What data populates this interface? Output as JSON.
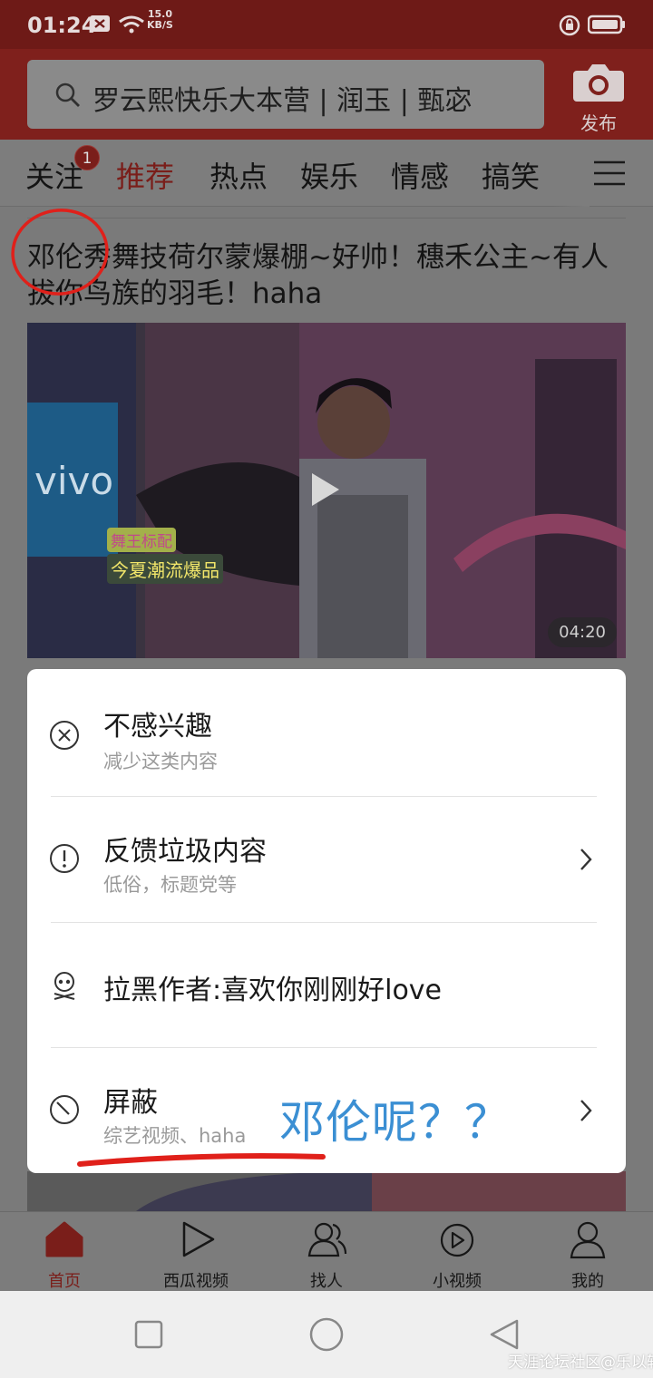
{
  "status_bar": {
    "time": "01:24",
    "speed_value": "15.0",
    "speed_unit": "KB/S"
  },
  "header": {
    "search_text": "罗云熙快乐大本营 | 润玉 | 甄宓",
    "publish_label": "发布"
  },
  "tabs": {
    "items": [
      {
        "label": "关注",
        "badge": "1"
      },
      {
        "label": "推荐"
      },
      {
        "label": "热点"
      },
      {
        "label": "娱乐"
      },
      {
        "label": "情感"
      },
      {
        "label": "搞笑"
      }
    ],
    "active_index": 1
  },
  "feed": {
    "headline": "邓伦秀舞技荷尔蒙爆棚~好帅！穗禾公主~有人拔你鸟族的羽毛！haha",
    "video": {
      "duration": "04:20",
      "overlay_line1": "舞王标配",
      "overlay_line2": "今夏潮流爆品",
      "brand_text": "vivo"
    }
  },
  "popup": {
    "items": [
      {
        "title": "不感兴趣",
        "subtitle": "减少这类内容",
        "icon": "close-circle-icon"
      },
      {
        "title": "反馈垃圾内容",
        "subtitle": "低俗，标题党等",
        "icon": "exclamation-circle-icon",
        "has_chevron": true
      },
      {
        "title": "拉黑作者:喜欢你刚刚好love",
        "icon": "skull-icon"
      },
      {
        "title": "屏蔽",
        "subtitle": "综艺视频、haha",
        "icon": "block-icon",
        "has_chevron": true
      }
    ]
  },
  "annotation": {
    "text": "邓伦呢？？",
    "color": "#3b8fd3",
    "circle_color": "#e0201a"
  },
  "bottom_nav": {
    "items": [
      {
        "label": "首页",
        "icon": "home-icon"
      },
      {
        "label": "西瓜视频",
        "icon": "play-icon"
      },
      {
        "label": "找人",
        "icon": "people-icon"
      },
      {
        "label": "小视频",
        "icon": "small-video-icon"
      },
      {
        "label": "我的",
        "icon": "person-icon"
      }
    ],
    "active_index": 0
  },
  "watermark": "天涯论坛社区@乐以轩",
  "colors": {
    "brand_red": "#7f201c",
    "dim_overlay": "#7a7a7a",
    "popup_bg": "#ffffff"
  }
}
